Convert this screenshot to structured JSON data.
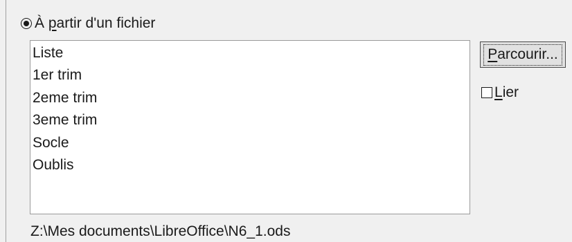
{
  "source_option": {
    "label_prefix": "À ",
    "label_mnemonic": "p",
    "label_rest": "artir d'un fichier",
    "selected": true
  },
  "list": {
    "items": [
      "Liste",
      "1er trim",
      "2eme trim",
      "3eme trim",
      "Socle",
      "Oublis"
    ]
  },
  "browse_button": {
    "label_mnemonic": "P",
    "label_rest": "arcourir..."
  },
  "link_checkbox": {
    "label_mnemonic": "L",
    "label_rest": "ier",
    "checked": false
  },
  "file_path": "Z:\\Mes documents\\LibreOffice\\N6_1.ods"
}
